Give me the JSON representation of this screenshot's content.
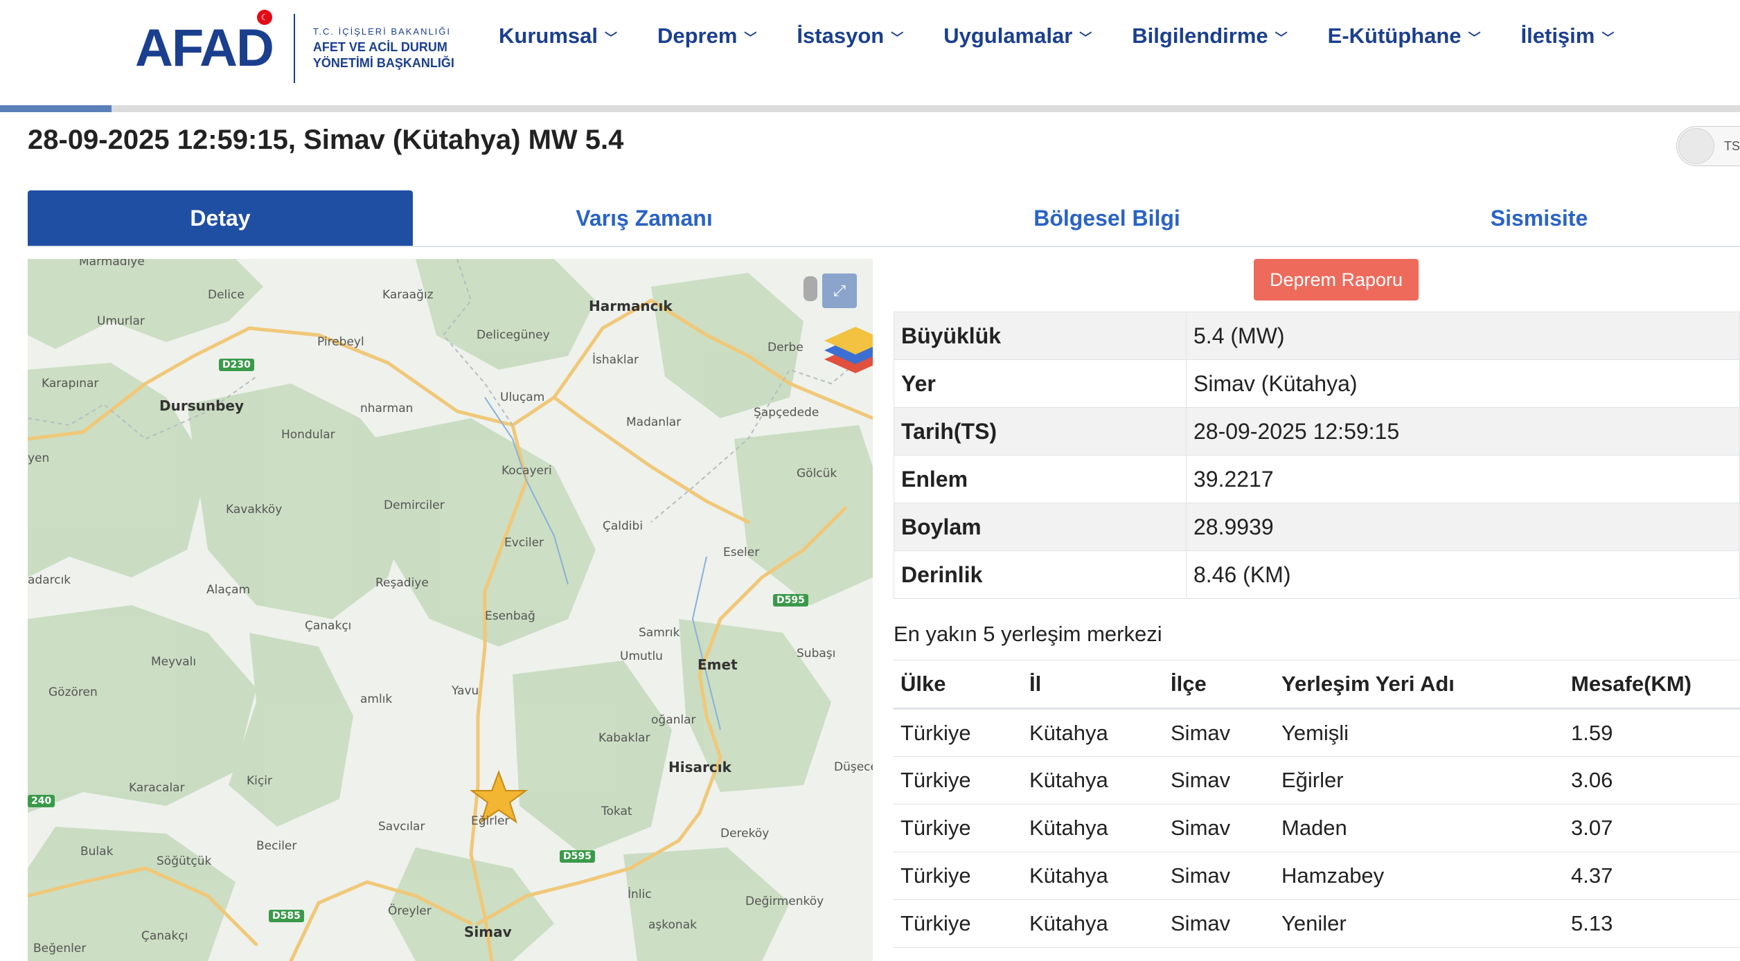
{
  "header": {
    "logo": "AFAD",
    "logo_sub": [
      "T.C. İÇİŞLERİ BAKANLIĞI",
      "AFET VE ACİL DURUM",
      "YÖNETİMİ BAŞKANLIĞI"
    ],
    "nav": [
      "Kurumsal",
      "Deprem",
      "İstasyon",
      "Uygulamalar",
      "Bilgilendirme",
      "E-Kütüphane",
      "İletişim"
    ],
    "progress_percent": 6.4
  },
  "title": "28-09-2025 12:59:15, Simav (Kütahya) MW 5.4",
  "toggle_label": "TS",
  "tabs": [
    "Detay",
    "Varış Zamanı",
    "Bölgesel Bilgi",
    "Sismisite"
  ],
  "active_tab": "Detay",
  "map": {
    "towns": [
      "Harmancık",
      "Dursunbey",
      "Emet",
      "Hisarcık",
      "Simav"
    ],
    "villages": [
      "Delice",
      "Karaağız",
      "Umurlar",
      "Pirebeyl",
      "Delicegüney",
      "İshaklar",
      "Karapınar",
      "Uluçam",
      "Şapçedede",
      "nharman",
      "Madanlar",
      "Hondular",
      "Kocayeri",
      "Gölcük",
      "Kavakköy",
      "Demirciler",
      "Çaldibi",
      "Evciler",
      "Eseler",
      "Alaçam",
      "Reşadiye",
      "Esenbağ",
      "Çanakçı",
      "Samrık",
      "Umutlu",
      "Subaşı",
      "Meyvalı",
      "Gözören",
      "amlık",
      "Yavu",
      "oğanlar",
      "Kabaklar",
      "Karacalar",
      "Kiçir",
      "Düşece",
      "Savcılar",
      "Eğirler",
      "Tokat",
      "Dereköy",
      "Bulak",
      "Söğütçük",
      "Beciler",
      "İnlic",
      "Değirmenköy",
      "Öreyler",
      "aşkonak",
      "Çanakçı",
      "Beğenler",
      "Marmadiye",
      "Derbe",
      "adarcık",
      "yen"
    ],
    "roads": [
      "D230",
      "D595",
      "D595",
      "D585",
      "240"
    ],
    "fullscreen_icon": "expand-icon",
    "layers_icon": "layers-icon",
    "epicenter_icon": "star-icon"
  },
  "report_button": "Deprem Raporu",
  "details": [
    {
      "label": "Büyüklük",
      "value": "5.4 (MW)"
    },
    {
      "label": "Yer",
      "value": "Simav (Kütahya)"
    },
    {
      "label": "Tarih(TS)",
      "value": "28-09-2025 12:59:15"
    },
    {
      "label": "Enlem",
      "value": "39.2217"
    },
    {
      "label": "Boylam",
      "value": "28.9939"
    },
    {
      "label": "Derinlik",
      "value": "8.46 (KM)"
    }
  ],
  "nearest_title": "En yakın 5 yerleşim merkezi",
  "nearest_headers": [
    "Ülke",
    "İl",
    "İlçe",
    "Yerleşim Yeri Adı",
    "Mesafe(KM)"
  ],
  "nearest_rows": [
    [
      "Türkiye",
      "Kütahya",
      "Simav",
      "Yemişli",
      "1.59"
    ],
    [
      "Türkiye",
      "Kütahya",
      "Simav",
      "Eğirler",
      "3.06"
    ],
    [
      "Türkiye",
      "Kütahya",
      "Simav",
      "Maden",
      "3.07"
    ],
    [
      "Türkiye",
      "Kütahya",
      "Simav",
      "Hamzabey",
      "4.37"
    ],
    [
      "Türkiye",
      "Kütahya",
      "Simav",
      "Yeniler",
      "5.13"
    ]
  ],
  "colors": {
    "brand": "#1b3f8f",
    "tab_active": "#1f4fa3",
    "tab_link": "#2a63c6",
    "report": "#ee6a5b",
    "map_green": "#c9dcc1",
    "map_road": "#f0c878"
  }
}
